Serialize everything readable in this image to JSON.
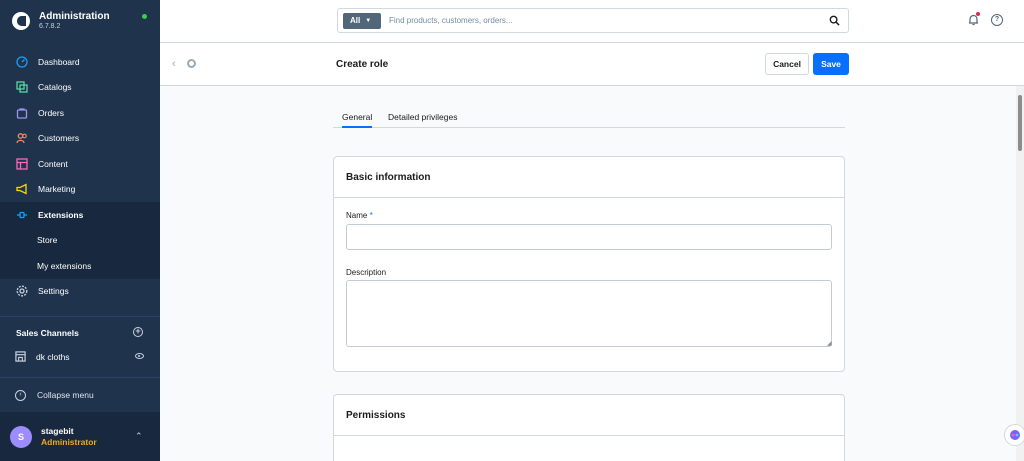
{
  "brand": {
    "title": "Administration",
    "version": "6.7.8.2"
  },
  "nav": [
    {
      "label": "Dashboard",
      "icon": "gauge-icon",
      "color": "#189eff"
    },
    {
      "label": "Catalogs",
      "icon": "products-icon",
      "color": "#57d9a3"
    },
    {
      "label": "Orders",
      "icon": "shopping-bag-icon",
      "color": "#a092f0"
    },
    {
      "label": "Customers",
      "icon": "users-icon",
      "color": "#f88962"
    },
    {
      "label": "Content",
      "icon": "content-icon",
      "color": "#ff68b4"
    },
    {
      "label": "Marketing",
      "icon": "megaphone-icon",
      "color": "#ffd700"
    },
    {
      "label": "Extensions",
      "icon": "plug-icon",
      "color": "#189eff"
    }
  ],
  "nav_sub": [
    {
      "label": "Store"
    },
    {
      "label": "My extensions"
    }
  ],
  "settings": {
    "label": "Settings"
  },
  "sales_channels": {
    "heading": "Sales Channels",
    "items": [
      {
        "label": "dk cloths"
      }
    ]
  },
  "collapse": {
    "label": "Collapse menu"
  },
  "user": {
    "initial": "S",
    "name": "stagebit",
    "role": "Administrator"
  },
  "search": {
    "type": "All",
    "placeholder": "Find products, customers, orders..."
  },
  "smartbar": {
    "title": "Create role",
    "cancel": "Cancel",
    "save": "Save"
  },
  "tabs": [
    {
      "label": "General"
    },
    {
      "label": "Detailed privileges"
    }
  ],
  "basic_info": {
    "title": "Basic information",
    "name_label": "Name",
    "name_required": "*",
    "name_value": "",
    "description_label": "Description",
    "description_value": ""
  },
  "permissions": {
    "title": "Permissions"
  },
  "colors": {
    "sidebar": "#1f334d",
    "accent": "#0870ff",
    "online": "#37d046"
  }
}
